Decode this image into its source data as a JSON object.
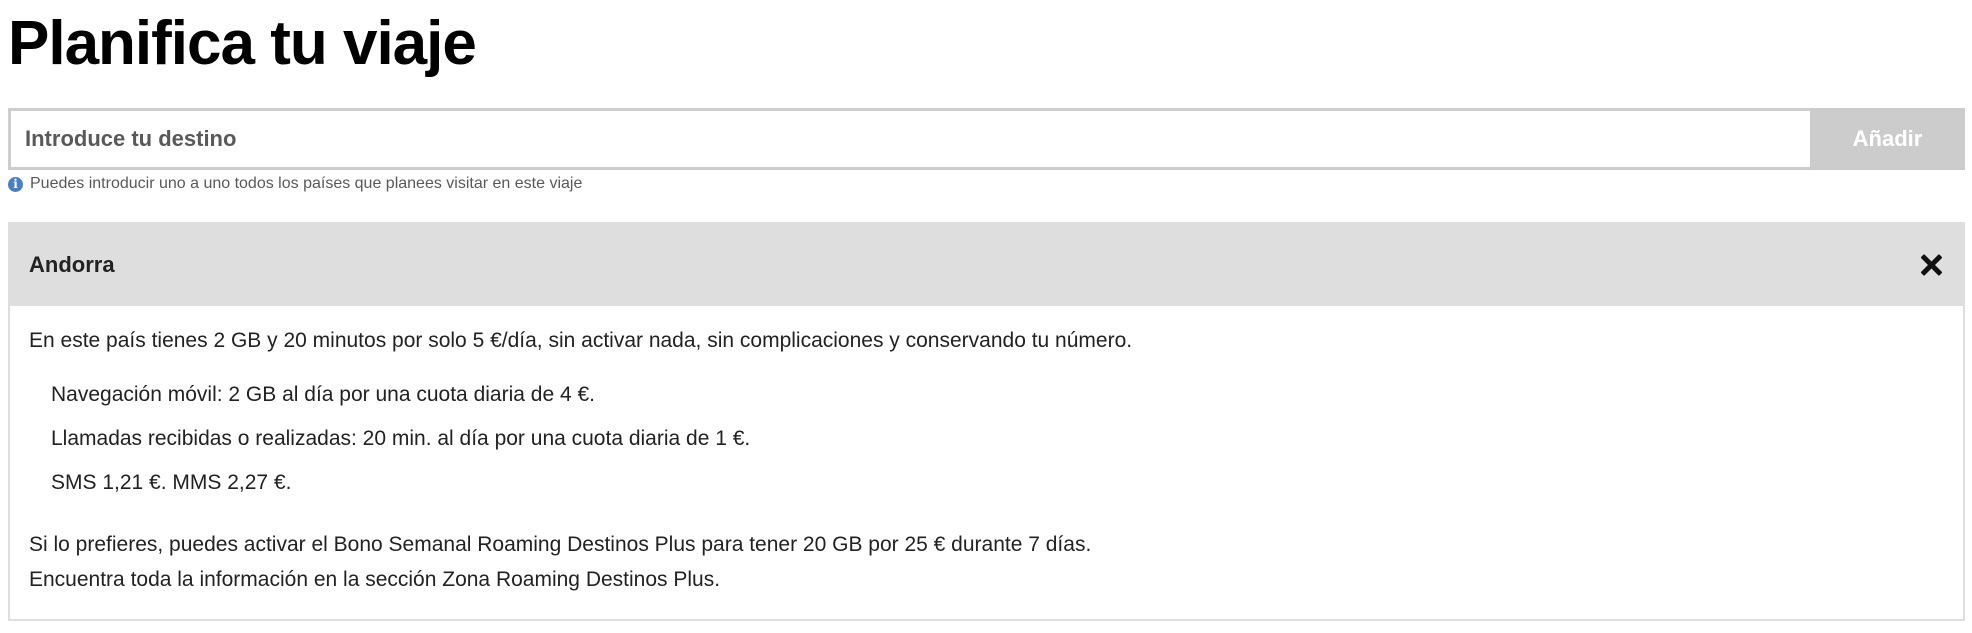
{
  "header": {
    "title": "Planifica tu viaje"
  },
  "search": {
    "placeholder": "Introduce tu destino",
    "add_label": "Añadir",
    "hint": "Puedes introducir uno a uno todos los países que planees visitar en este viaje",
    "hint_icon": "info-icon"
  },
  "destination": {
    "name": "Andorra",
    "close_icon": "close-icon",
    "intro": "En este país tienes 2 GB y 20 minutos por solo 5 €/día, sin activar nada, sin complicaciones y conservando tu número.",
    "items": [
      {
        "text": "Navegación móvil: 2 GB al día por una cuota diaria de 4 €."
      },
      {
        "text": "Llamadas recibidas o realizadas: 20 min. al día por una cuota diaria de 1 €."
      },
      {
        "text": "SMS 1,21 €. MMS 2,27 €."
      }
    ],
    "extra_line1": "Si lo prefieres, puedes activar el Bono Semanal Roaming Destinos Plus para tener 20 GB por 25 € durante 7 días.",
    "extra_line2": "Encuentra toda la información en la sección Zona Roaming Destinos Plus."
  },
  "colors": {
    "panel_header_bg": "#dedede",
    "button_bg": "#cccccc",
    "info_icon": "#4a7fc1"
  }
}
